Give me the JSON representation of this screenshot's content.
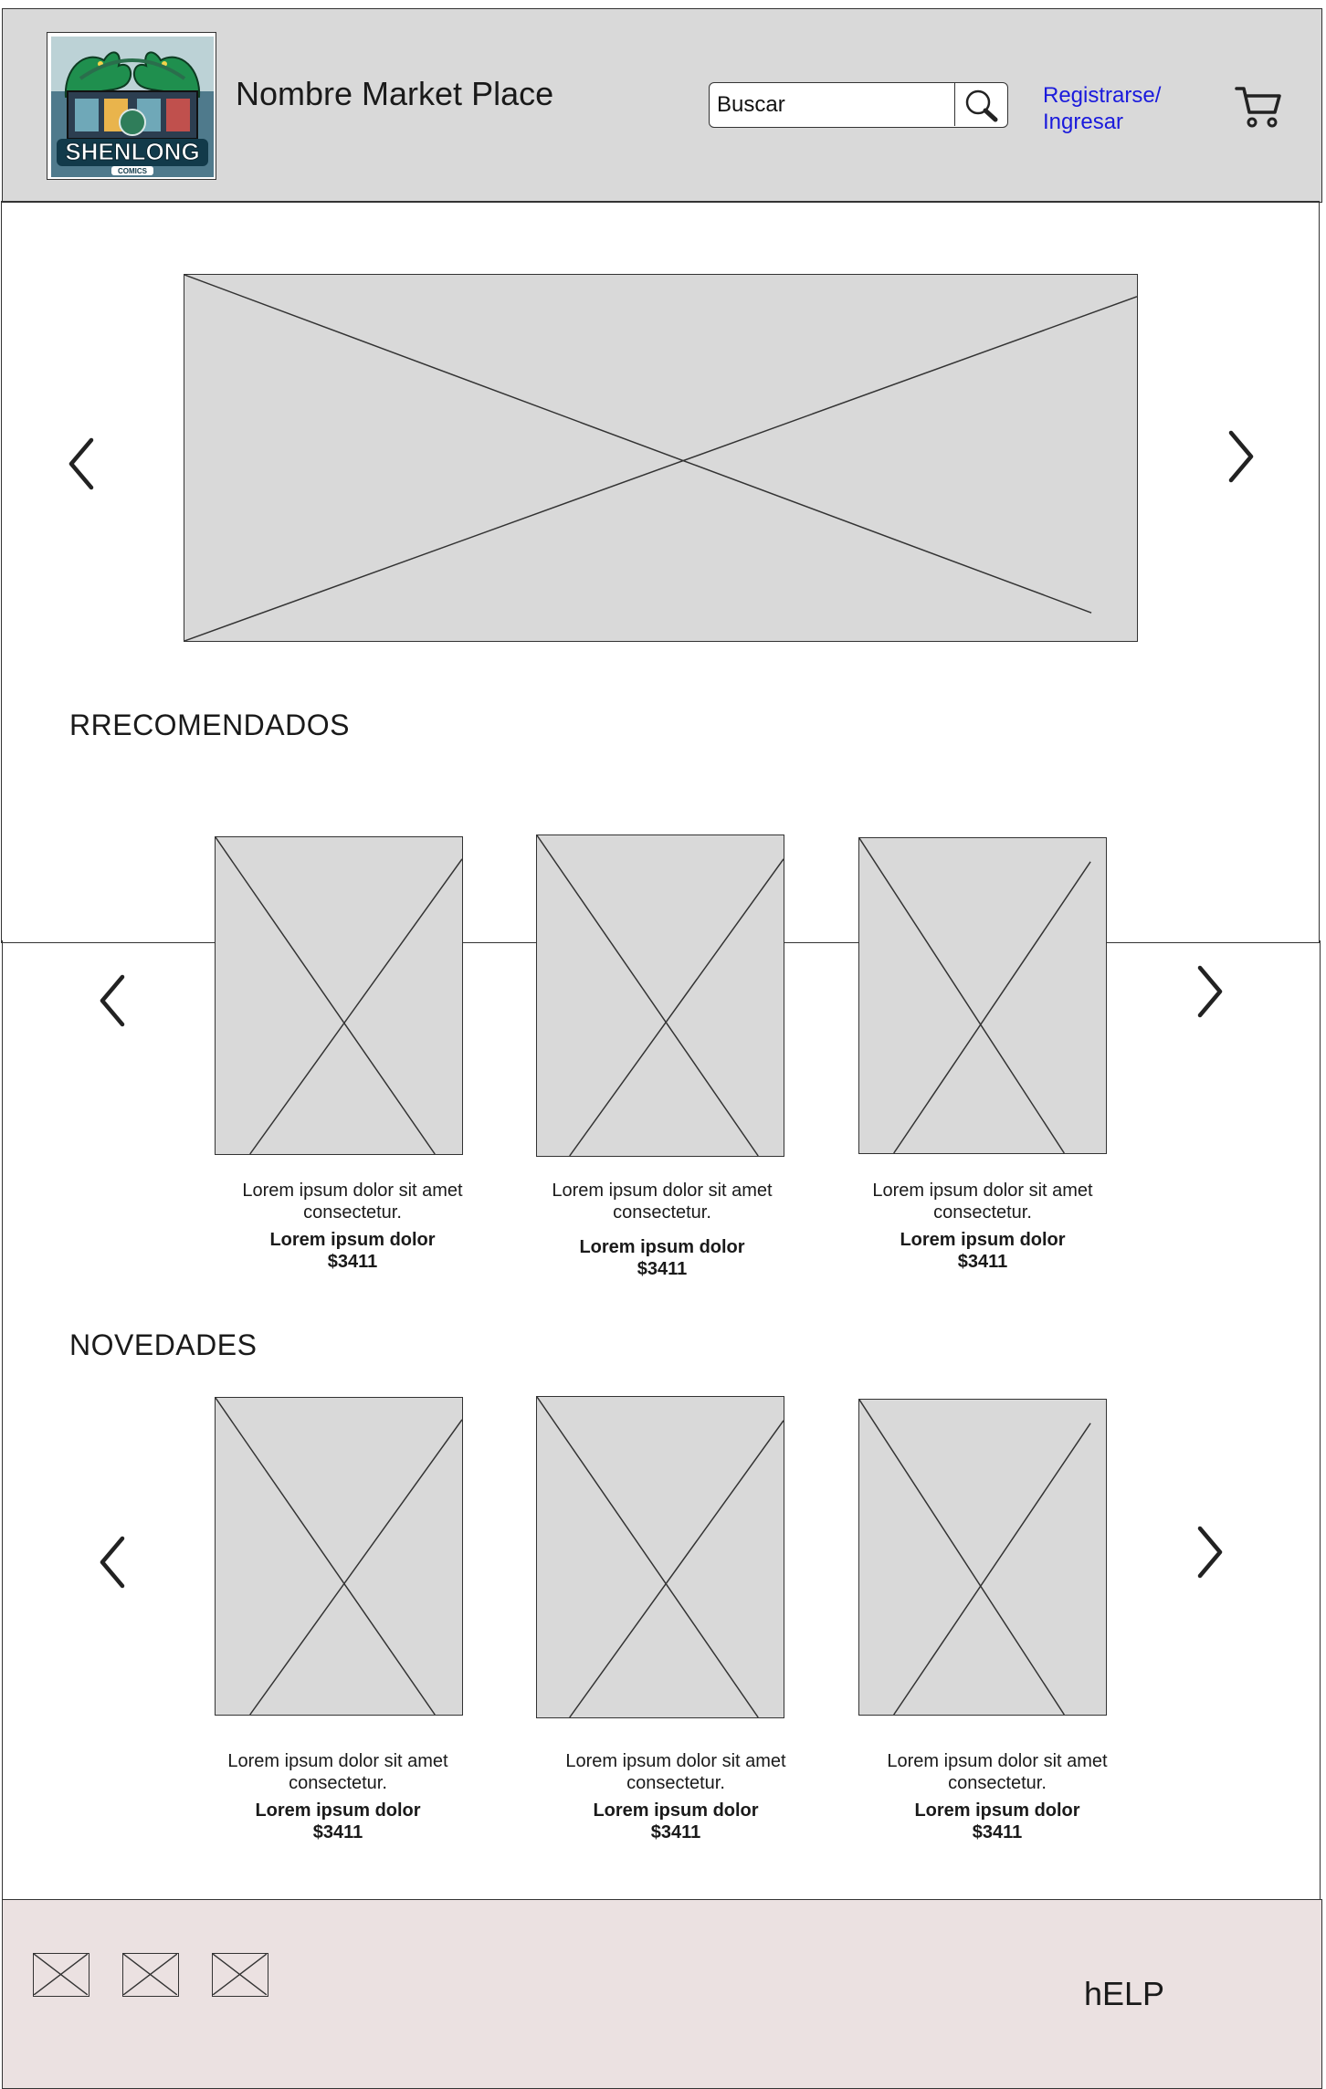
{
  "header": {
    "logo": {
      "icon": "shenlong-comics-logo",
      "lettering": "SHENLONG COMICS"
    },
    "site_title": "Nombre Market Place",
    "search": {
      "placeholder": "Buscar",
      "value": ""
    },
    "login_link": {
      "line1": "Registrarse/",
      "line2": "Ingresar",
      "color": "#1a1adc"
    },
    "cart": {
      "icon": "cart-icon"
    }
  },
  "hero": {
    "image": "image-placeholder",
    "prev_icon": "chevron-left-icon",
    "next_icon": "chevron-right-icon"
  },
  "sections": {
    "recommended": {
      "title": "RRECOMENDADOS",
      "items": [
        {
          "desc1": "Lorem ipsum dolor sit amet",
          "desc2": "consectetur.",
          "name": "Lorem ipsum dolor",
          "price": "$3411"
        },
        {
          "desc1": "Lorem ipsum dolor sit amet",
          "desc2": "consectetur.",
          "name": "Lorem ipsum dolor",
          "price": "$3411"
        },
        {
          "desc1": "Lorem ipsum dolor sit amet",
          "desc2": "consectetur.",
          "name": "Lorem ipsum dolor",
          "price": "$3411"
        }
      ]
    },
    "new": {
      "title": "NOVEDADES",
      "items": [
        {
          "desc1": "Lorem ipsum dolor sit amet",
          "desc2": "consectetur.",
          "name": "Lorem ipsum dolor",
          "price": "$3411"
        },
        {
          "desc1": "Lorem ipsum dolor sit amet",
          "desc2": "consectetur.",
          "name": "Lorem ipsum dolor",
          "price": "$3411"
        },
        {
          "desc1": "Lorem ipsum dolor sit amet",
          "desc2": "consectetur.",
          "name": "Lorem ipsum dolor",
          "price": "$3411"
        }
      ]
    }
  },
  "footer": {
    "social_icons": [
      "image-placeholder",
      "image-placeholder",
      "image-placeholder"
    ],
    "help_label": "hELP"
  },
  "colors": {
    "header_bg": "#d9d9d9",
    "footer_bg": "#ebe1e1",
    "link": "#1a1adc",
    "placeholder_bg": "#d9d9d9"
  }
}
